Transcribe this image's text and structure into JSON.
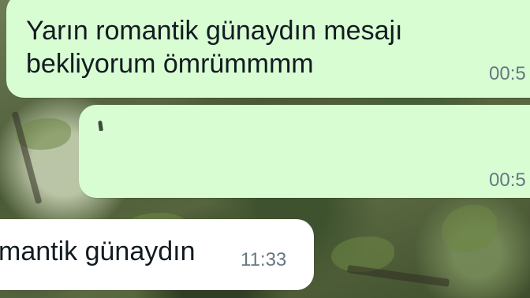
{
  "chat": {
    "messages": [
      {
        "direction": "outgoing",
        "text": "Yarın romantik günaydın mesajı\nbekliyorum ömrümmmm",
        "time": "00:5"
      },
      {
        "direction": "outgoing",
        "text": "",
        "time": "00:5"
      },
      {
        "direction": "incoming",
        "text": "mantik günaydın",
        "time": "11:33"
      }
    ]
  },
  "colors": {
    "outgoing_bubble": "#d9fdd3",
    "incoming_bubble": "#ffffff",
    "timestamp": "#667781",
    "text": "#111b21"
  }
}
